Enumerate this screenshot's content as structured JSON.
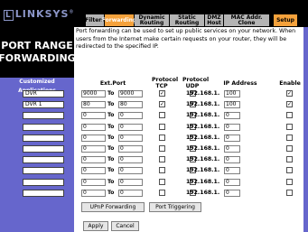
{
  "brand": {
    "logo_text": "LINKSYS",
    "logo_box": "L",
    "registered": "®"
  },
  "tabs": [
    {
      "label": "Filters"
    },
    {
      "label": "Forwarding"
    },
    {
      "label": "Dynamic Routing"
    },
    {
      "label": "Static Routing"
    },
    {
      "label": "DMZ Host"
    },
    {
      "label": "MAC Addr. Clone"
    },
    {
      "label": "Setup"
    }
  ],
  "page": {
    "title_line1": "PORT RANGE",
    "title_line2": "FORWARDING",
    "description": "Port forwarding can be used to set up public services on your network. When users from the Internet make certain requests on your router, they will be redirected to the specified IP."
  },
  "table": {
    "headers": {
      "applications": "Customized Applications",
      "ext_port": "Ext.Port",
      "protocol_tcp": "Protocol TCP",
      "protocol_udp": "Protocol UDP",
      "ip_address": "IP Address",
      "enable": "Enable"
    },
    "to_label": "To",
    "ip_prefix": "192.168.1.",
    "rows": [
      {
        "name": "DVR",
        "from": "9000",
        "to": "9000",
        "tcp": true,
        "udp": true,
        "ip": "100",
        "enable": true
      },
      {
        "name": "DVR 1",
        "from": "80",
        "to": "80",
        "tcp": true,
        "udp": true,
        "ip": "100",
        "enable": true
      },
      {
        "name": "",
        "from": "0",
        "to": "0",
        "tcp": false,
        "udp": false,
        "ip": "0",
        "enable": false
      },
      {
        "name": "",
        "from": "0",
        "to": "0",
        "tcp": false,
        "udp": false,
        "ip": "0",
        "enable": false
      },
      {
        "name": "",
        "from": "0",
        "to": "0",
        "tcp": false,
        "udp": false,
        "ip": "0",
        "enable": false
      },
      {
        "name": "",
        "from": "0",
        "to": "0",
        "tcp": false,
        "udp": false,
        "ip": "0",
        "enable": false
      },
      {
        "name": "",
        "from": "0",
        "to": "0",
        "tcp": false,
        "udp": false,
        "ip": "0",
        "enable": false
      },
      {
        "name": "",
        "from": "0",
        "to": "0",
        "tcp": false,
        "udp": false,
        "ip": "0",
        "enable": false
      },
      {
        "name": "",
        "from": "0",
        "to": "0",
        "tcp": false,
        "udp": false,
        "ip": "0",
        "enable": false
      },
      {
        "name": "",
        "from": "0",
        "to": "0",
        "tcp": false,
        "udp": false,
        "ip": "0",
        "enable": false
      }
    ]
  },
  "buttons": {
    "upnp": "UPnP Forwarding",
    "triggering": "Port Triggering",
    "apply": "Apply",
    "cancel": "Cancel"
  },
  "colors": {
    "accent": "#f5a23c",
    "panel": "#6666cc",
    "tab": "#b4b4b4"
  }
}
